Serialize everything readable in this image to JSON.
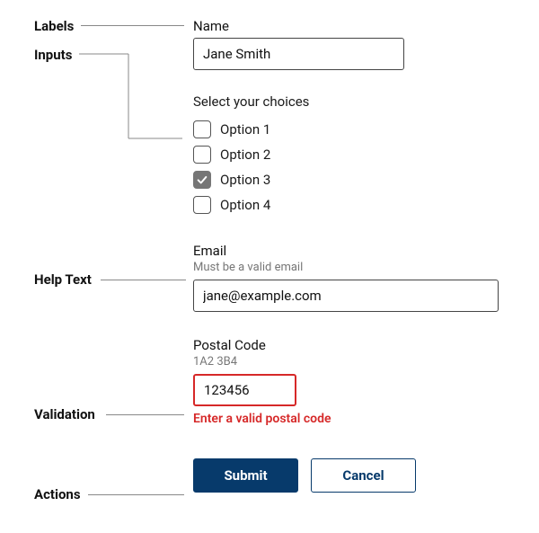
{
  "annotations": {
    "labels": "Labels",
    "inputs": "Inputs",
    "help_text": "Help Text",
    "validation": "Validation",
    "actions": "Actions"
  },
  "form": {
    "name": {
      "label": "Name",
      "value": "Jane Smith"
    },
    "choices": {
      "title": "Select your choices",
      "options": [
        {
          "label": "Option 1",
          "checked": false
        },
        {
          "label": "Option 2",
          "checked": false
        },
        {
          "label": "Option 3",
          "checked": true
        },
        {
          "label": "Option 4",
          "checked": false
        }
      ]
    },
    "email": {
      "label": "Email",
      "help": "Must be a valid email",
      "value": "jane@example.com"
    },
    "postal": {
      "label": "Postal Code",
      "help": "1A2 3B4",
      "value": "123456",
      "error": "Enter a valid postal code"
    }
  },
  "actions": {
    "submit": "Submit",
    "cancel": "Cancel"
  }
}
